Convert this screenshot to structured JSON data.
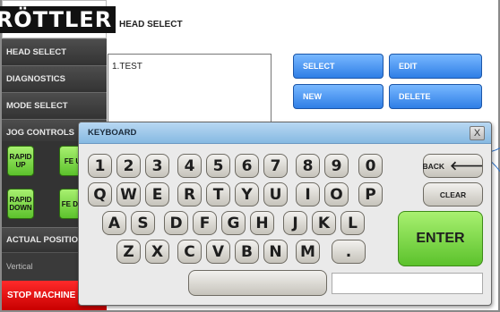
{
  "brand": {
    "logo": "RÖTTLER"
  },
  "sidebar": {
    "items": [
      {
        "label": "HEAD SELECT"
      },
      {
        "label": "DIAGNOSTICS"
      },
      {
        "label": "MODE SELECT"
      },
      {
        "label": "JOG CONTROLS"
      }
    ],
    "jog": [
      {
        "label": "RAPID UP"
      },
      {
        "label": "FE U"
      },
      {
        "label": "RAPID DOWN"
      },
      {
        "label": "FE DO"
      }
    ],
    "actual_position": "ACTUAL POSITION",
    "vertical": "Vertical",
    "stop": "STOP MACHINE"
  },
  "main": {
    "title": "HEAD SELECT",
    "list": [
      "1.TEST"
    ],
    "buttons": {
      "select": "SELECT",
      "edit": "EDIT",
      "new": "NEW",
      "delete": "DELETE"
    }
  },
  "keyboard": {
    "title": "KEYBOARD",
    "close": "X",
    "row_numbers": [
      "1",
      "2",
      "3",
      "4",
      "5",
      "6",
      "7",
      "8",
      "9",
      "0"
    ],
    "row_top": [
      "Q",
      "W",
      "E",
      "R",
      "T",
      "Y",
      "U",
      "I",
      "O",
      "P"
    ],
    "row_mid": [
      "A",
      "S",
      "D",
      "F",
      "G",
      "H",
      "J",
      "K",
      "L"
    ],
    "row_bot": [
      "Z",
      "X",
      "C",
      "V",
      "B",
      "N",
      "M",
      "."
    ],
    "back": "BACK",
    "back_arrow": "🡐",
    "clear": "CLEAR",
    "enter": "ENTER",
    "input_value": ""
  },
  "colors": {
    "sidebar_bg": "#3a3a3a",
    "green_button": "#6fd23c",
    "blue_button": "#3c8df0",
    "stop_red": "#e80000",
    "dialog_header": "#9cc7ea"
  }
}
